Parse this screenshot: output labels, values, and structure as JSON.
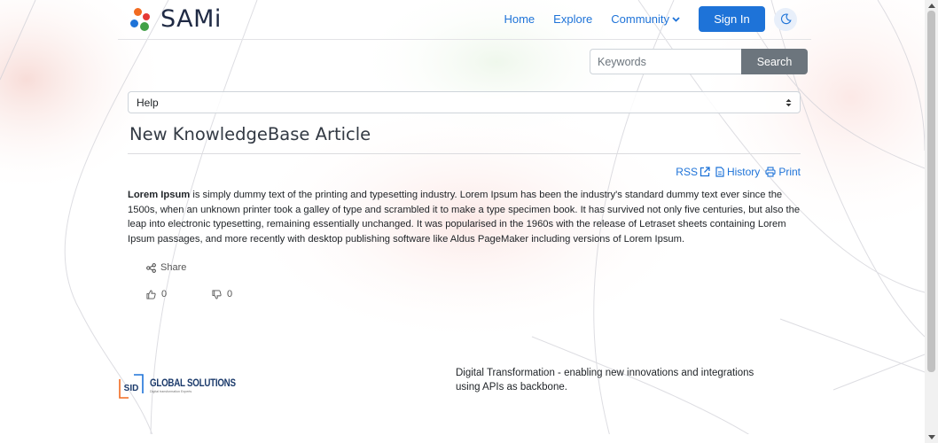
{
  "colors": {
    "brand_blue": "#1e73d8",
    "search_button": "#6c757d",
    "logo_orange": "#f26b21",
    "logo_red": "#e53935",
    "logo_green": "#43a047",
    "logo_blue": "#1e73d8"
  },
  "header": {
    "logo_text": "SAMi",
    "nav": {
      "home": "Home",
      "explore": "Explore",
      "community": "Community",
      "signin": "Sign In"
    },
    "theme_icon": "moon-icon"
  },
  "search": {
    "placeholder": "Keywords",
    "button_label": "Search"
  },
  "category_select": {
    "selected": "Help"
  },
  "article": {
    "title": "New KnowledgeBase Article",
    "tools": {
      "rss": "RSS",
      "history": "History",
      "print": "Print"
    },
    "lead": "Lorem Ipsum",
    "body": " is simply dummy text of the printing and typesetting industry. Lorem Ipsum has been the industry's standard dummy text ever since the 1500s, when an unknown printer took a galley of type and scrambled it to make a type specimen book. It has survived not only five centuries, but also the leap into electronic typesetting, remaining essentially unchanged. It was popularised in the 1960s with the release of Letraset sheets containing Lorem Ipsum passages, and more recently with desktop publishing software like Aldus PageMaker including versions of Lorem Ipsum.",
    "share_label": "Share",
    "likes": "0",
    "dislikes": "0"
  },
  "footer": {
    "logo_mark": "SID",
    "logo_title": "GLOBAL SOLUTIONS",
    "logo_subtitle": "Digital transformation Experts",
    "tagline": "Digital Transformation - enabling new innovations and integrations using APIs as backbone."
  }
}
